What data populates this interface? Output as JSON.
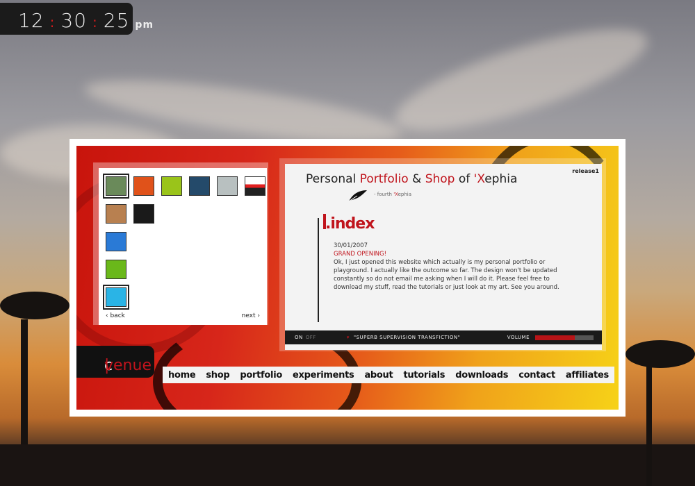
{
  "clock": {
    "hours": "12",
    "minutes": "30",
    "seconds": "25",
    "ampm": "pm"
  },
  "thumbnails": {
    "items": [
      {
        "color": "#6a8a5a"
      },
      {
        "color": "#e0521a"
      },
      {
        "color": "#9ac41a"
      },
      {
        "color": "#244a6a"
      },
      {
        "color": "#b8c0c0"
      },
      {
        "color": "#e22020"
      },
      {
        "color": "#b88050"
      },
      {
        "color": "#1a1a1a"
      },
      {
        "color": "#2a7ad6"
      },
      {
        "color": "#6ab81a"
      },
      {
        "color": "#2ab4e6"
      }
    ],
    "back_label": "back",
    "next_label": "next"
  },
  "content": {
    "title_part1": "Personal ",
    "title_part2": "Portfolio",
    "title_part3": " & ",
    "title_part4": "Shop",
    "title_part5": " of ",
    "title_part6": "'X",
    "title_part7": "ephia",
    "release": "release1",
    "signature_prefix": "- fourth ",
    "signature_x": "'X",
    "signature_rest": "ephia",
    "section_title": ".index",
    "post_date": "30/01/2007",
    "post_heading": "GRAND OPENING!",
    "post_body": "Ok, I just opened this website which actually is my personal portfolio or playground. I actually like the outcome so far. The design won't be updated constantly so do not email me asking when I will do it. Please feel free to download my stuff, read the tutorials or just look at my art. See you around."
  },
  "player": {
    "on_label": "ON",
    "off_label": "OFF",
    "song": "\"SUPERB SUPERVISION TRANSFICTION\"",
    "volume_label": "VOLUME",
    "volume_level": 0.68
  },
  "logo": {
    "part1": "c",
    "sep": "|",
    "part2": "venue"
  },
  "nav": {
    "items": [
      "home",
      "shop",
      "portfolio",
      "experiments",
      "about",
      "tutorials",
      "downloads",
      "contact",
      "affiliates"
    ]
  },
  "colors": {
    "accent": "#c0141c"
  }
}
